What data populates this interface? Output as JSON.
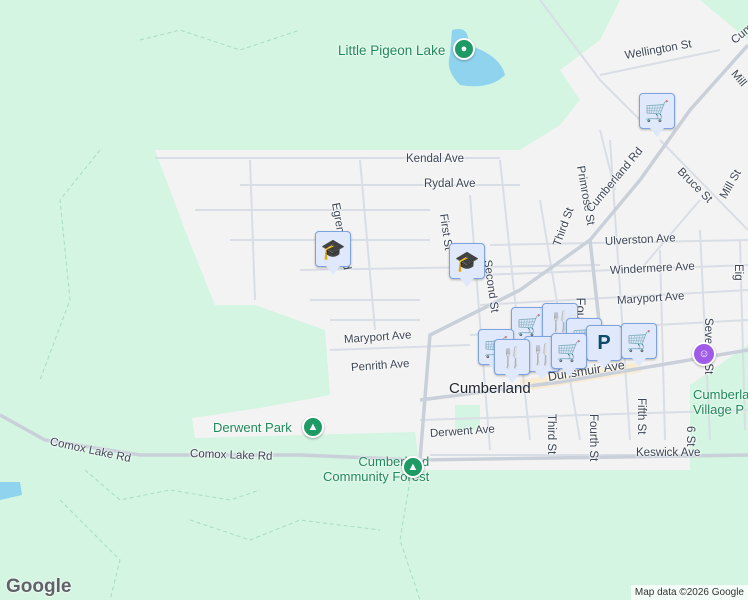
{
  "map": {
    "town": "Cumberland",
    "lake": "Little Pigeon Lake",
    "streets": {
      "wellington": "Wellington St",
      "kendal": "Kendal Ave",
      "rydal": "Rydal Ave",
      "egremont": "Egremont Rd",
      "first": "First St",
      "second": "Second St",
      "third_n": "Third St",
      "primrose": "Primrose St",
      "cumberland_rd": "Cumberland Rd",
      "bruce": "Bruce St",
      "mill": "Mill St",
      "mill_top": "Mill",
      "cum_top": "Cum",
      "ulverston": "Ulverston Ave",
      "windermere": "Windermere Ave",
      "fourth_n": "Fourth",
      "maryport_e": "Maryport Ave",
      "maryport_w": "Maryport Ave",
      "seventh": "Seventh St",
      "eig": "Eig",
      "penrith": "Penrith Ave",
      "dunsmuir": "Dunsmuir Ave",
      "third_s": "Third St",
      "fourth_s": "Fourth St",
      "fifth": "Fifth St",
      "sixth": "6 St",
      "derwent": "Derwent Ave",
      "keswick": "Keswick Ave",
      "comox1": "Comox Lake Rd",
      "comox2": "Comox Lake Rd"
    },
    "parks": {
      "derwent_park": "Derwent Park",
      "community_forest_1": "Cumberland",
      "community_forest_2": "Community Forest",
      "village_park_1": "Cumberland",
      "village_park_2": "Village P"
    },
    "markers": [
      {
        "type": "school-icon",
        "glyph": "🎓"
      },
      {
        "type": "school-icon",
        "glyph": "🎓"
      },
      {
        "type": "shopping-cart-icon",
        "glyph": "🛒"
      },
      {
        "type": "shopping-cart-icon",
        "glyph": "🛒"
      },
      {
        "type": "restaurant-icon",
        "glyph": "🍴"
      },
      {
        "type": "shopping-cart-icon",
        "glyph": "🛒"
      },
      {
        "type": "parking-icon",
        "glyph": "P"
      },
      {
        "type": "shopping-cart-icon",
        "glyph": "🛒"
      },
      {
        "type": "restaurant-icon",
        "glyph": "🍴"
      },
      {
        "type": "shopping-cart-icon",
        "glyph": "🛒"
      },
      {
        "type": "restaurant-icon",
        "glyph": "🍴"
      },
      {
        "type": "shopping-cart-icon",
        "glyph": "🛒"
      }
    ],
    "colors": {
      "park": "#d3f5e1",
      "urban": "#f4f3f3",
      "water": "#8fd3ef",
      "road": "#d7dce4",
      "marker": "#dfe9fb"
    }
  },
  "footer": {
    "logo": "Google",
    "attribution": "Map data ©2026 Google"
  }
}
